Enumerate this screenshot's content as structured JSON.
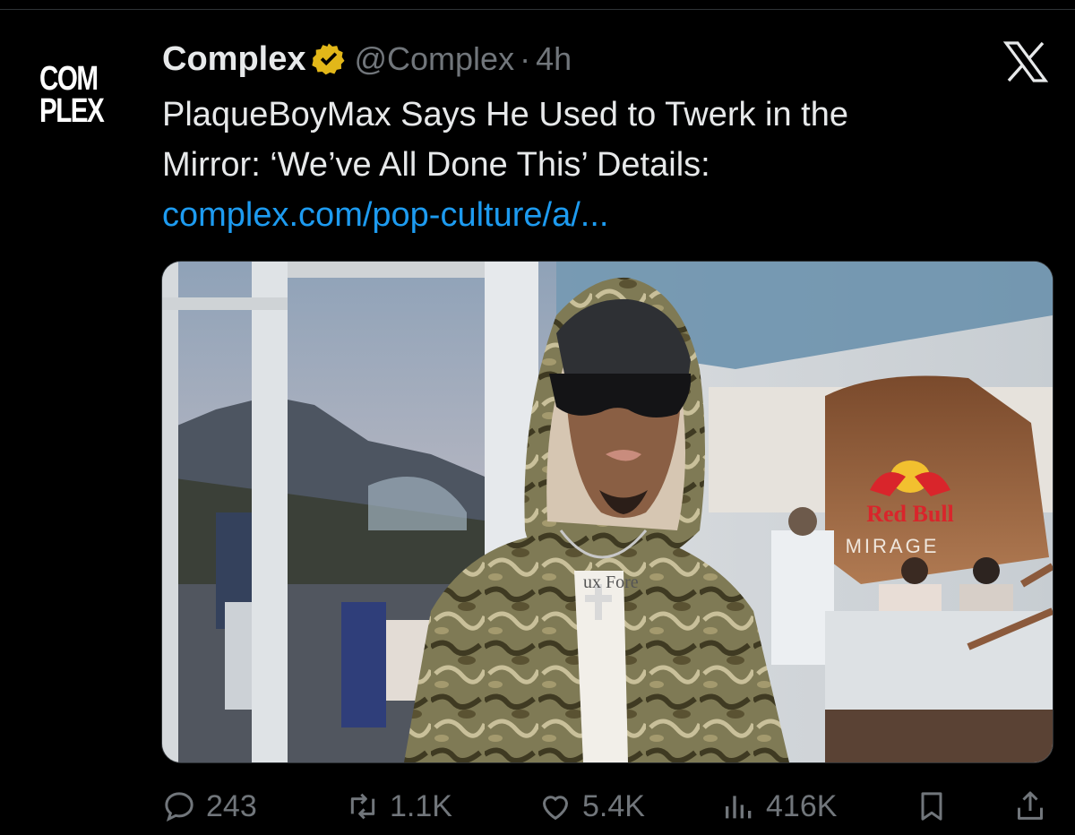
{
  "avatar": {
    "line1": "COM",
    "line2": "PLEX"
  },
  "tweet": {
    "author_name": "Complex",
    "handle": "@Complex",
    "separator": "·",
    "time": "4h",
    "text_line1": "PlaqueBoyMax Says He Used to Twerk in the",
    "text_line2": "Mirror: ‘We’ve All Done This’ Details:",
    "link": "complex.com/pop-culture/a/..."
  },
  "media": {
    "sign_brand": "Red Bull",
    "sign_venue": "MIRAGE",
    "shirt_text": "ux Fore"
  },
  "actions": {
    "replies": "243",
    "reposts": "1.1K",
    "likes": "5.4K",
    "views": "416K"
  },
  "icons": [
    "verified-icon",
    "x-logo-icon",
    "reply-icon",
    "repost-icon",
    "like-icon",
    "views-icon",
    "bookmark-icon",
    "share-icon"
  ],
  "colors": {
    "background": "#000000",
    "text": "#e7e9ea",
    "muted": "#71767b",
    "link": "#1d9bf0",
    "verified": "#e2b719"
  }
}
